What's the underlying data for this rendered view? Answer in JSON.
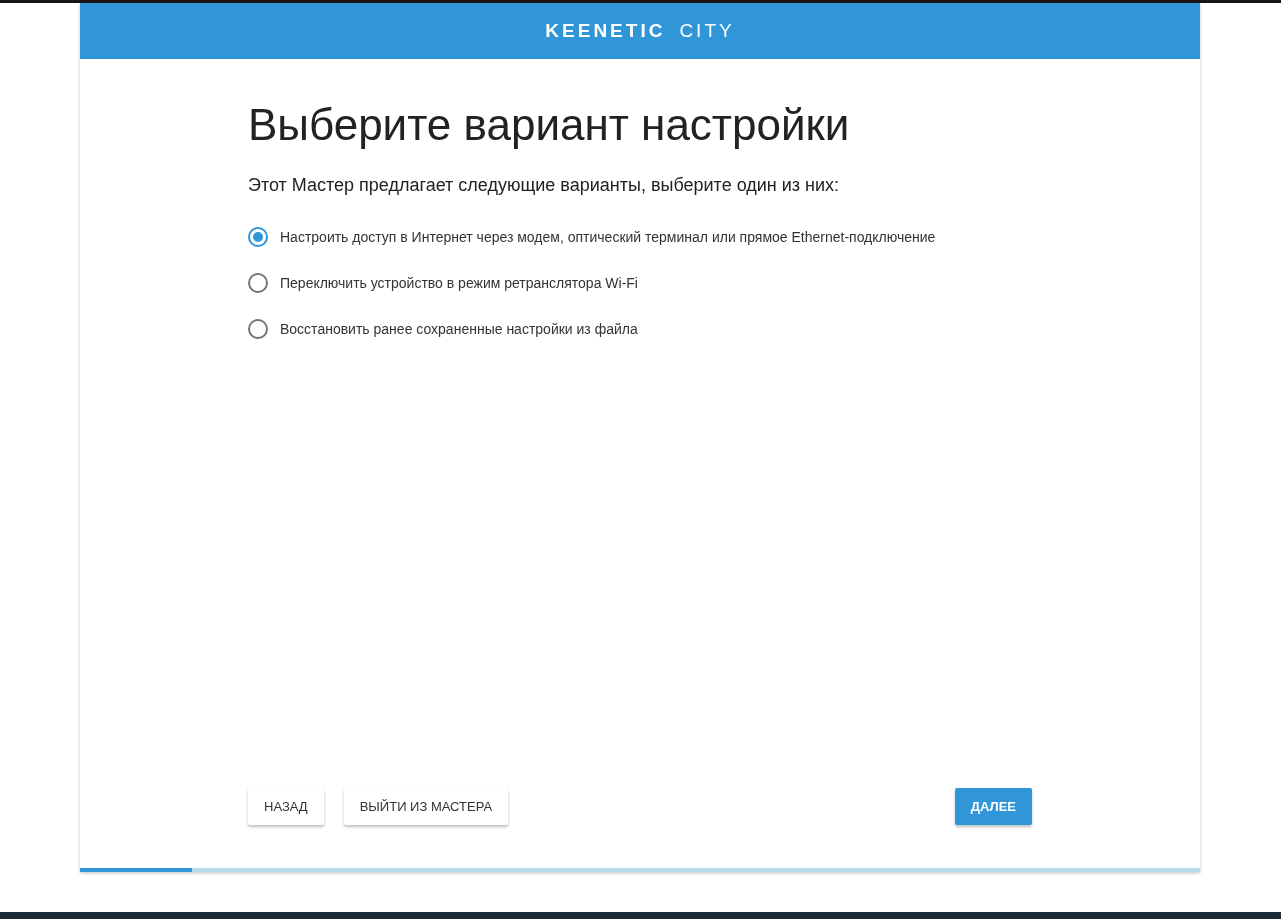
{
  "header": {
    "brand": "KEENETIC",
    "product": "CITY"
  },
  "title": "Выберите вариант настройки",
  "subtitle": "Этот Мастер предлагает следующие варианты, выберите один из них:",
  "options": [
    {
      "label": "Настроить доступ в Интернет через модем, оптический терминал или прямое Ethernet-подключение",
      "selected": true
    },
    {
      "label": "Переключить устройство в режим ретранслятора Wi-Fi",
      "selected": false
    },
    {
      "label": "Восстановить ранее сохраненные настройки из файла",
      "selected": false
    }
  ],
  "buttons": [
    {
      "label": "НАЗАД",
      "kind": "secondary"
    },
    {
      "label": "ВЫЙТИ ИЗ МАСТЕРА",
      "kind": "secondary"
    },
    {
      "label": "ДАЛЕЕ",
      "kind": "primary"
    }
  ],
  "progress": {
    "level": 0.1
  }
}
